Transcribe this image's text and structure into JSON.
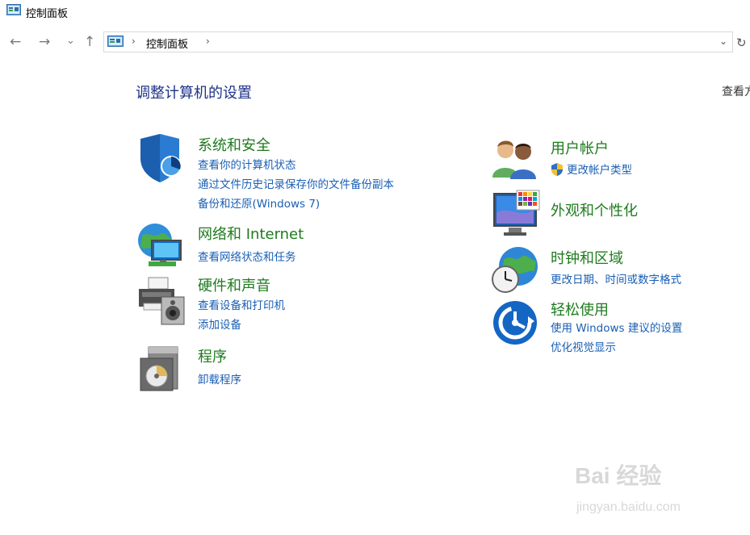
{
  "window": {
    "title": "控制面板"
  },
  "nav": {
    "back": "←",
    "forward": "→",
    "recent": "⌄",
    "up": "↑",
    "breadcrumb": "控制面板",
    "separator": "›",
    "dropdown": "⌄",
    "refresh": "↻"
  },
  "main": {
    "heading": "调整计算机的设置",
    "view_by": "查看方式"
  },
  "categories_left": [
    {
      "title": "系统和安全",
      "links": [
        "查看你的计算机状态",
        "通过文件历史记录保存你的文件备份副本",
        "备份和还原(Windows 7)"
      ],
      "icon": "shield-icon"
    },
    {
      "title": "网络和 Internet",
      "links": [
        "查看网络状态和任务"
      ],
      "icon": "network-icon"
    },
    {
      "title": "硬件和声音",
      "links": [
        "查看设备和打印机",
        "添加设备"
      ],
      "icon": "printer-icon"
    },
    {
      "title": "程序",
      "links": [
        "卸载程序"
      ],
      "icon": "programs-icon"
    }
  ],
  "categories_right": [
    {
      "title": "用户帐户",
      "links": [
        "更改帐户类型"
      ],
      "icon": "users-icon"
    },
    {
      "title": "外观和个性化",
      "links": [],
      "icon": "display-icon"
    },
    {
      "title": "时钟和区域",
      "links": [
        "更改日期、时间或数字格式"
      ],
      "icon": "clock-globe-icon"
    },
    {
      "title": "轻松使用",
      "links": [
        "使用 Windows 建议的设置",
        "优化视觉显示"
      ],
      "icon": "ease-of-access-icon"
    }
  ],
  "watermark": {
    "brand": "Bai 经验",
    "url": "jingyan.baidu.com"
  },
  "colors": {
    "heading": "#1e3287",
    "category_title": "#1e7b1e",
    "link": "#1a5fb4"
  }
}
